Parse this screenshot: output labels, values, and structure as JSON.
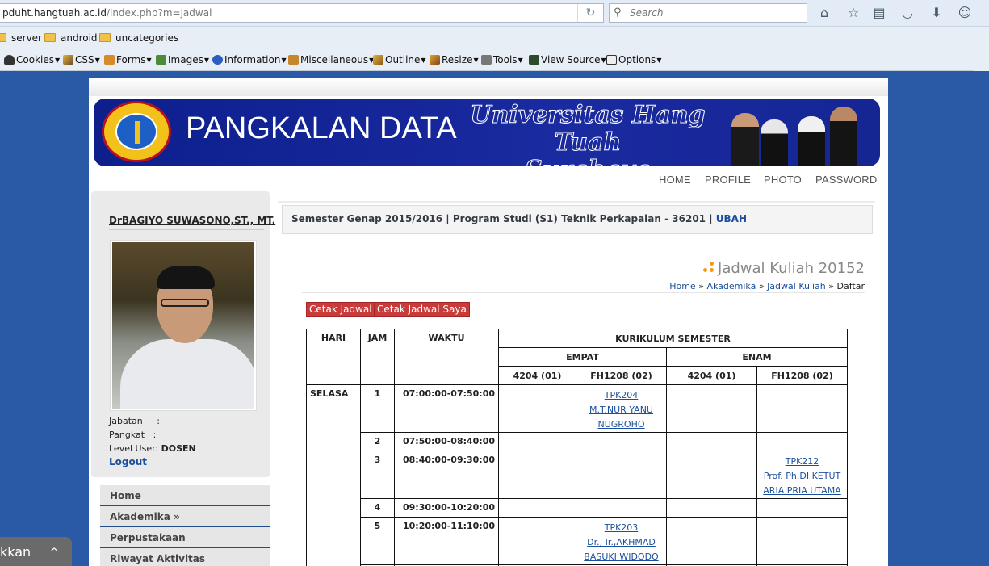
{
  "browser": {
    "url_host": "pduht.hangtuah.ac.id",
    "url_path": "/index.php?m=jadwal",
    "url_prefix": "",
    "search_placeholder": "Search",
    "bookmarks": [
      "server",
      "android",
      "uncategories"
    ],
    "devtools": [
      "Cookies",
      "CSS",
      "Forms",
      "Images",
      "Information",
      "Miscellaneous",
      "Outline",
      "Resize",
      "Tools",
      "View Source",
      "Options"
    ]
  },
  "banner": {
    "title": "PANGKALAN DATA",
    "script_line1": "Universitas Hang Tuah",
    "script_line2": "Surabaya"
  },
  "topnav": [
    "HOME",
    "PROFILE",
    "PHOTO",
    "PASSWORD"
  ],
  "user": {
    "name": "DrBAGIYO SUWASONO,ST., MT.",
    "jabatan_label": "Jabatan",
    "jabatan_value": ":",
    "pangkat_label": "Pangkat",
    "pangkat_value": ":",
    "level_label": "Level User:",
    "level_value": "DOSEN",
    "logout": "Logout"
  },
  "menu": [
    "Home",
    "Akademika »",
    "Perpustakaan",
    "Riwayat Aktivitas"
  ],
  "semester": {
    "text": "Semester Genap 2015/2016 | Program Studi (S1) Teknik Perkapalan - 36201 |",
    "ubah": "UBAH"
  },
  "page_title": "Jadwal Kuliah 20152",
  "breadcrumb": {
    "home": "Home",
    "sep1": "»",
    "akademika": "Akademika",
    "sep2": "»",
    "jadwal": "Jadwal Kuliah",
    "sep3": "»",
    "current": "Daftar"
  },
  "buttons": {
    "cetak": "Cetak Jadwal",
    "cetak_saya": "Cetak Jadwal Saya"
  },
  "table": {
    "headers": {
      "hari": "HARI",
      "jam": "JAM",
      "waktu": "WAKTU",
      "kurikulum": "KURIKULUM SEMESTER",
      "empat": "EMPAT",
      "enam": "ENAM",
      "cols": [
        "4204 (01)",
        "FH1208 (02)",
        "4204 (01)",
        "FH1208 (02)"
      ]
    },
    "day": "SELASA",
    "rows": [
      {
        "jam": "1",
        "waktu": "07:00:00-07:50:00",
        "cells": [
          "",
          "TPK204|M.T.NUR YANU|NUGROHO",
          "",
          ""
        ]
      },
      {
        "jam": "2",
        "waktu": "07:50:00-08:40:00",
        "cells": [
          "",
          "",
          "",
          ""
        ]
      },
      {
        "jam": "3",
        "waktu": "08:40:00-09:30:00",
        "cells": [
          "",
          "",
          "",
          "TPK212|Prof. Ph.DI KETUT|ARIA PRIA UTAMA"
        ]
      },
      {
        "jam": "4",
        "waktu": "09:30:00-10:20:00",
        "cells": [
          "",
          "",
          "",
          ""
        ]
      },
      {
        "jam": "5",
        "waktu": "10:20:00-11:10:00",
        "cells": [
          "",
          "TPK203|Dr., Ir.,AKHMAD|BASUKI WIDODO",
          "",
          ""
        ]
      }
    ]
  },
  "popup": {
    "text": "kkan",
    "chevron": "^"
  },
  "colors": {
    "page_bg": "#2a5aa6",
    "banner": "#0d1f8c",
    "link": "#1b4f9c",
    "button": "#c93a3a",
    "accent_dots": "#f39a1c"
  }
}
